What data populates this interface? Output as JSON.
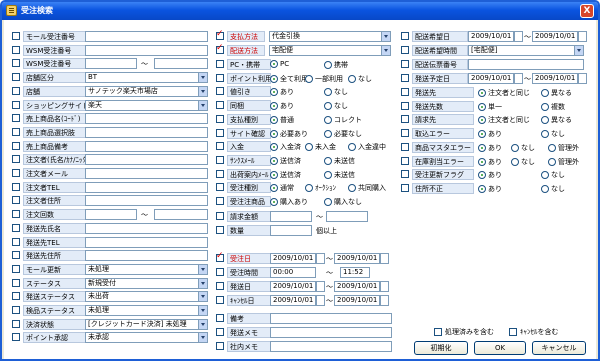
{
  "window": {
    "title": "受注検索",
    "close_label": "X"
  },
  "col1": {
    "fields": [
      {
        "label": "モール受注番号",
        "value": ""
      },
      {
        "label": "WSM受注番号",
        "value": ""
      },
      {
        "label": "WSM受注番号",
        "value": "",
        "range_sep": "～",
        "value2": ""
      },
      {
        "label": "店舗区分",
        "select": "BT"
      },
      {
        "label": "店舗",
        "select": "サノテック楽天市場店"
      },
      {
        "label": "ショッピングサイト",
        "select": "楽天"
      },
      {
        "label": "売上商品名(ｺｰﾄﾞ)",
        "value": ""
      },
      {
        "label": "売上商品選択肢",
        "value": ""
      },
      {
        "label": "売上商品備考",
        "value": ""
      },
      {
        "label": "注文者(氏名/ｶﾅ/ﾆｯｸﾈｰﾑ)",
        "value": ""
      },
      {
        "label": "注文者メール",
        "value": ""
      },
      {
        "label": "注文者TEL",
        "value": ""
      },
      {
        "label": "注文者住所",
        "value": ""
      },
      {
        "label": "注文回数",
        "value": "",
        "range_sep": "～",
        "value2": ""
      },
      {
        "label": "発送先氏名",
        "value": ""
      },
      {
        "label": "発送先TEL",
        "value": ""
      },
      {
        "label": "発送先住所",
        "value": ""
      },
      {
        "label": "モール更新",
        "select": "未処理"
      },
      {
        "label": "ステータス",
        "select": "新規受付"
      },
      {
        "label": "発送ステータス",
        "select": "未出荷"
      },
      {
        "label": "検品ステータス",
        "select": "未処理"
      },
      {
        "label": "決済状態",
        "select": "[クレジットカード決済] 未処理"
      },
      {
        "label": "ポイント承認",
        "select": "未承認"
      }
    ]
  },
  "col2": {
    "payment_label": "支払方法",
    "payment_value": "代金引換",
    "delivery_label": "配送方法",
    "delivery_value": "宅配便",
    "radios": [
      {
        "label": "PC・携帯",
        "opts": [
          "PC",
          "携帯"
        ],
        "on": 0
      },
      {
        "label": "ポイント利用",
        "opts": [
          "全て利用",
          "一部利用",
          "なし"
        ],
        "on": 0
      },
      {
        "label": "値引き",
        "opts": [
          "あり",
          "なし"
        ],
        "on": 0
      },
      {
        "label": "同梱",
        "opts": [
          "あり",
          "なし"
        ],
        "on": 0
      },
      {
        "label": "支払種別",
        "opts": [
          "普通",
          "コレクト"
        ],
        "on": 0
      },
      {
        "label": "サイト確認",
        "opts": [
          "必要あり",
          "必要なし"
        ],
        "on": 0
      },
      {
        "label": "入金",
        "opts": [
          "入金済",
          "未入金",
          "入金違中"
        ],
        "on": 0
      },
      {
        "label": "ｻﾝｸｽﾒｰﾙ",
        "opts": [
          "送信済",
          "未送信"
        ],
        "on": 0
      },
      {
        "label": "出荷案内ﾒｰﾙ",
        "opts": [
          "送信済",
          "未送信"
        ],
        "on": 0
      },
      {
        "label": "受注種別",
        "opts": [
          "通常",
          "ｵｰｸｼｮﾝ",
          "共同購入"
        ],
        "on": 0
      },
      {
        "label": "受注注商品",
        "opts": [
          "購入あり",
          "購入なし"
        ],
        "on": 0
      }
    ],
    "amount_label": "請求金額",
    "amount_sep": "～",
    "qty_label": "数量",
    "qty_suffix": "個以上",
    "order_date_label": "受注日",
    "order_date_from": "2009/10/01",
    "order_date_to": "2009/10/01",
    "order_time_label": "受注時間",
    "order_time_from": "00:00",
    "order_time_to": "11:52",
    "ship_date_label": "発送日",
    "ship_date_from": "2009/10/01",
    "ship_date_to": "2009/10/01",
    "cancel_date_label": "ｷｬﾝｾﾙ日",
    "cancel_date_from": "2009/10/01",
    "cancel_date_to": "2009/10/01",
    "memo_labels": [
      "備考",
      "発送メモ",
      "社内メモ"
    ],
    "date_sep": "～"
  },
  "col3": {
    "wish_date_label": "配送希望日",
    "wish_date_from": "2009/10/01",
    "wish_date_to": "2009/10/01",
    "wish_time_label": "配送希望時間",
    "wish_time_value": "[宅配便]",
    "slip_label": "配送伝票番号",
    "plan_label": "発送予定日",
    "plan_from": "2009/10/01",
    "plan_to": "2009/10/01",
    "radios": [
      {
        "label": "発送先",
        "opts": [
          "注文者と同じ",
          "異なる"
        ],
        "on": 0
      },
      {
        "label": "発送先数",
        "opts": [
          "単一",
          "複数"
        ],
        "on": 0
      },
      {
        "label": "請求先",
        "opts": [
          "注文者と同じ",
          "異なる"
        ],
        "on": 0
      },
      {
        "label": "取込エラー",
        "opts": [
          "あり",
          "なし"
        ],
        "on": 0
      },
      {
        "label": "商品マスタエラー",
        "opts": [
          "あり",
          "なし",
          "管理外"
        ],
        "on": 0
      },
      {
        "label": "在庫割当エラー",
        "opts": [
          "あり",
          "なし",
          "管理外"
        ],
        "on": 0
      },
      {
        "label": "受注更新フラグ",
        "opts": [
          "あり",
          "なし"
        ],
        "on": 0
      },
      {
        "label": "住所不正",
        "opts": [
          "あり",
          "なし"
        ],
        "on": 0
      }
    ],
    "include_processed": "処理済みを含む",
    "include_cancel": "ｷｬﾝｾﾙを含む",
    "btn_init": "初期化",
    "btn_ok": "OK",
    "btn_cancel": "キャンセル"
  }
}
